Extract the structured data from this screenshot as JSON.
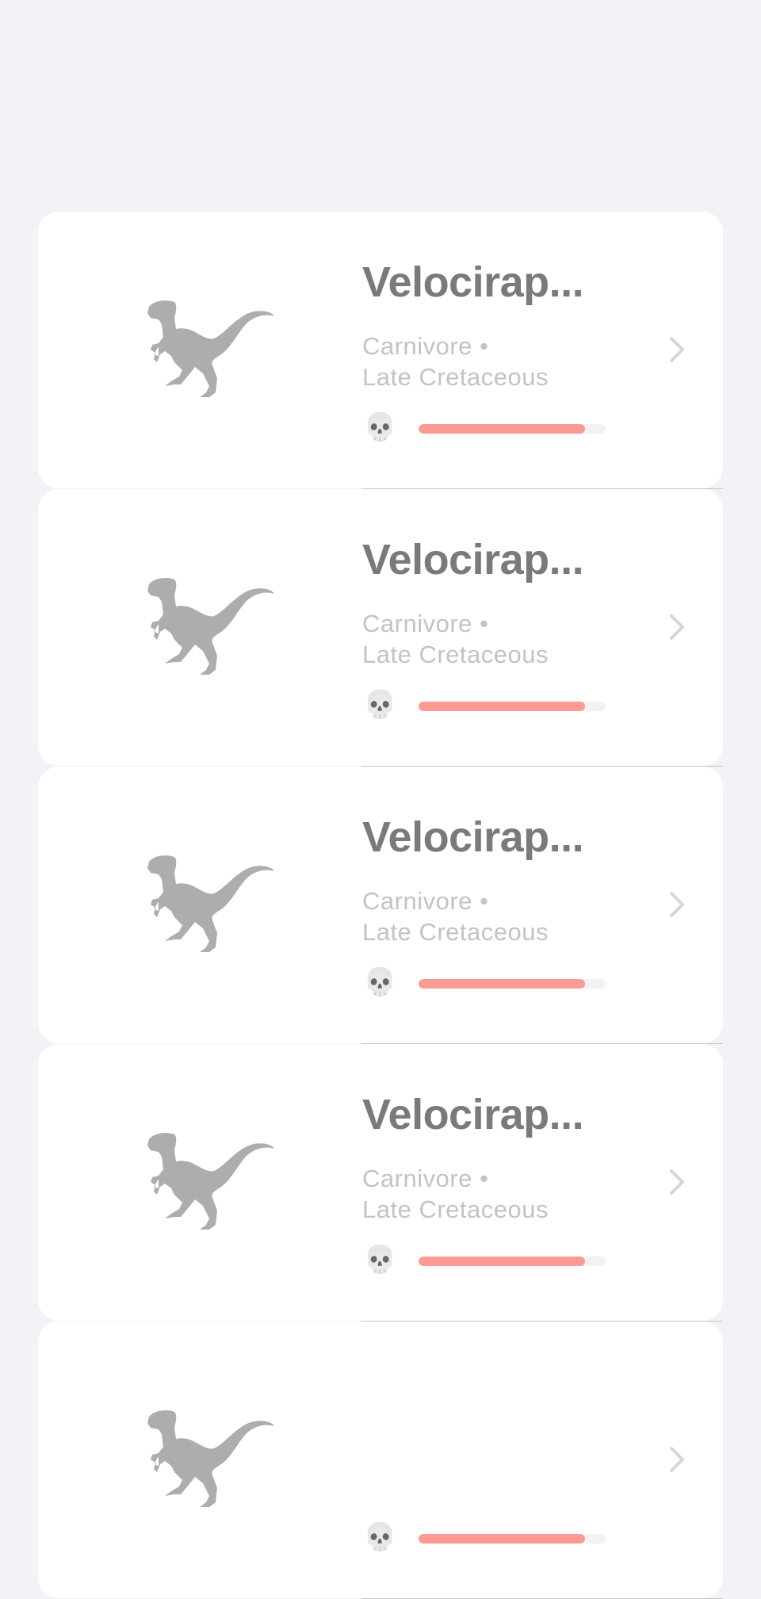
{
  "items": [
    {
      "name": "Velocirap...",
      "diet": "Carnivore",
      "separator": "•",
      "period": "Late Cretaceous",
      "danger_icon": "skull-icon",
      "danger_level": 0.89,
      "image_icon": "velociraptor-silhouette-icon"
    },
    {
      "name": "Velocirap...",
      "diet": "Carnivore",
      "separator": "•",
      "period": "Late Cretaceous",
      "danger_icon": "skull-icon",
      "danger_level": 0.89,
      "image_icon": "velociraptor-silhouette-icon"
    },
    {
      "name": "Velocirap...",
      "diet": "Carnivore",
      "separator": "•",
      "period": "Late Cretaceous",
      "danger_icon": "skull-icon",
      "danger_level": 0.89,
      "image_icon": "velociraptor-silhouette-icon"
    },
    {
      "name": "Velocirap...",
      "diet": "Carnivore",
      "separator": "•",
      "period": "Late Cretaceous",
      "danger_icon": "skull-icon",
      "danger_level": 0.89,
      "image_icon": "velociraptor-silhouette-icon"
    },
    {
      "name": "",
      "diet": "",
      "separator": "",
      "period": "",
      "danger_icon": "skull-icon",
      "danger_level": 0.89,
      "image_icon": "velociraptor-silhouette-icon"
    }
  ],
  "colors": {
    "background": "#f2f2f7",
    "card": "#ffffff",
    "title": "#7a7a7a",
    "subtitle": "#c3c3c3",
    "danger_fill": "#fb9b94",
    "danger_track": "#f2f2f2",
    "silhouette": "#adadad"
  }
}
